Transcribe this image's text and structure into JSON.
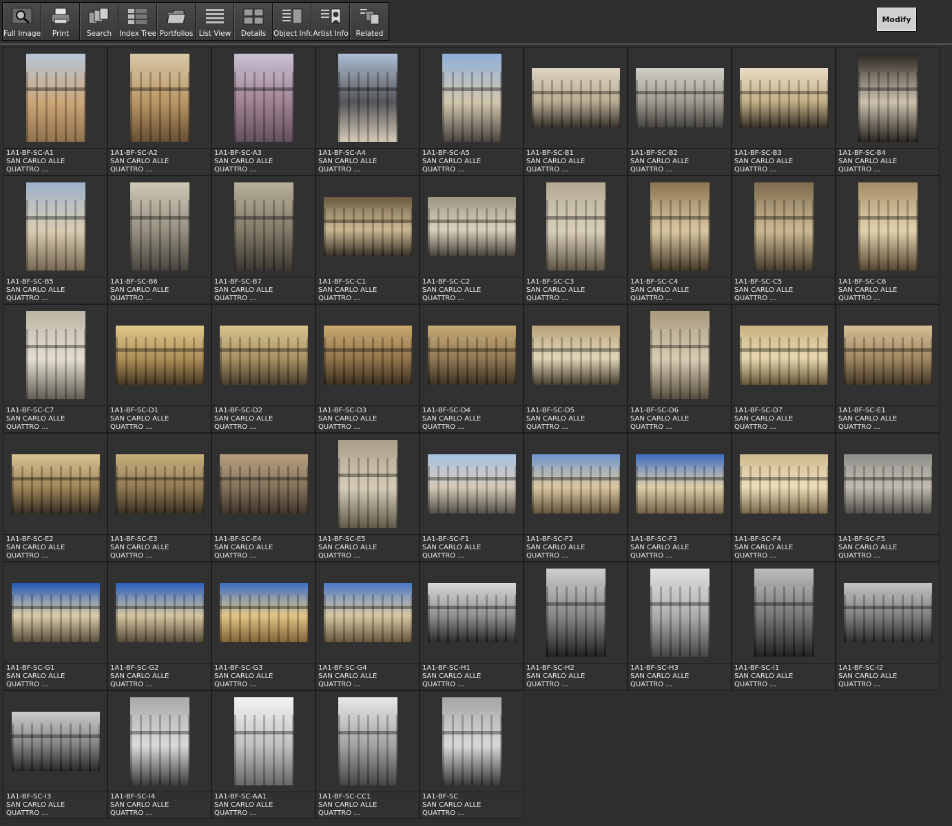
{
  "toolbar": {
    "buttons": [
      {
        "label": "Full Image",
        "icon": "magnifier-icon"
      },
      {
        "label": "Print",
        "icon": "printer-icon"
      },
      {
        "label": "Search",
        "icon": "search-stack-icon"
      },
      {
        "label": "Index Tree",
        "icon": "index-tree-icon"
      },
      {
        "label": "Portfolios",
        "icon": "folder-icon"
      },
      {
        "label": "List View",
        "icon": "list-icon"
      },
      {
        "label": "Details",
        "icon": "details-grid-icon"
      },
      {
        "label": "Object Info",
        "icon": "object-info-icon"
      },
      {
        "label": "Artist  Info",
        "icon": "artist-portrait-icon"
      },
      {
        "label": "Related",
        "icon": "related-icon"
      }
    ],
    "modify_label": "Modify"
  },
  "thumbnails": [
    {
      "id": "1A1-BF-SC-A1",
      "title": "SAN CARLO ALLE",
      "subtitle": "QUATTRO ...",
      "orient": "portrait",
      "palette": [
        "#b7c7d8",
        "#c8a070",
        "#8a6a44"
      ]
    },
    {
      "id": "1A1-BF-SC-A2",
      "title": "SAN CARLO ALLE",
      "subtitle": "QUATTRO ...",
      "orient": "portrait",
      "palette": [
        "#d8c9a8",
        "#b58f5b",
        "#5c4428"
      ]
    },
    {
      "id": "1A1-BF-SC-A3",
      "title": "SAN CARLO ALLE",
      "subtitle": "QUATTRO ...",
      "orient": "portrait",
      "palette": [
        "#c9c2d4",
        "#9a7b8c",
        "#5a4654"
      ]
    },
    {
      "id": "1A1-BF-SC-A4",
      "title": "SAN CARLO ALLE",
      "subtitle": "QUATTRO ...",
      "orient": "portrait",
      "palette": [
        "#aebfd6",
        "#4b4b4f",
        "#d2c7b1"
      ]
    },
    {
      "id": "1A1-BF-SC-A5",
      "title": "SAN CARLO ALLE",
      "subtitle": "QUATTRO ...",
      "orient": "portrait",
      "palette": [
        "#8fb0da",
        "#cfc3a9",
        "#3f3a34"
      ]
    },
    {
      "id": "1A1-BF-SC-B1",
      "title": "SAN CARLO ALLE",
      "subtitle": "QUATTRO ...",
      "orient": "landscape",
      "palette": [
        "#ddd3c0",
        "#b7a98e",
        "#2a2620"
      ]
    },
    {
      "id": "1A1-BF-SC-B2",
      "title": "SAN CARLO ALLE",
      "subtitle": "QUATTRO ...",
      "orient": "landscape",
      "palette": [
        "#d2cfc8",
        "#9b968c",
        "#3a3834"
      ]
    },
    {
      "id": "1A1-BF-SC-B3",
      "title": "SAN CARLO ALLE",
      "subtitle": "QUATTRO ...",
      "orient": "landscape",
      "palette": [
        "#e6dcc4",
        "#c3ad82",
        "#2e261a"
      ]
    },
    {
      "id": "1A1-BF-SC-B4",
      "title": "SAN CARLO ALLE",
      "subtitle": "QUATTRO ...",
      "orient": "portrait",
      "palette": [
        "#2b2722",
        "#c8bda8",
        "#1b1814"
      ]
    },
    {
      "id": "1A1-BF-SC-B5",
      "title": "SAN CARLO ALLE",
      "subtitle": "QUATTRO ...",
      "orient": "portrait",
      "palette": [
        "#9db1cc",
        "#d7c9ac",
        "#6e5f48"
      ]
    },
    {
      "id": "1A1-BF-SC-B6",
      "title": "SAN CARLO ALLE",
      "subtitle": "QUATTRO ...",
      "orient": "portrait",
      "palette": [
        "#cfc8b6",
        "#8f8878",
        "#3d3a33"
      ]
    },
    {
      "id": "1A1-BF-SC-B7",
      "title": "SAN CARLO ALLE",
      "subtitle": "QUATTRO ...",
      "orient": "portrait",
      "palette": [
        "#b9b09c",
        "#7a715f",
        "#2f2b24"
      ]
    },
    {
      "id": "1A1-BF-SC-C1",
      "title": "SAN CARLO ALLE",
      "subtitle": "QUATTRO ...",
      "orient": "landscape",
      "palette": [
        "#6b5a40",
        "#c9b58c",
        "#2c241a"
      ]
    },
    {
      "id": "1A1-BF-SC-C2",
      "title": "SAN CARLO ALLE",
      "subtitle": "QUATTRO ...",
      "orient": "landscape",
      "palette": [
        "#9c9482",
        "#d8cfba",
        "#3c372e"
      ]
    },
    {
      "id": "1A1-BF-SC-C3",
      "title": "SAN CARLO ALLE",
      "subtitle": "QUATTRO ...",
      "orient": "portrait",
      "palette": [
        "#b4aa93",
        "#d6ccb5",
        "#54493a"
      ]
    },
    {
      "id": "1A1-BF-SC-C4",
      "title": "SAN CARLO ALLE",
      "subtitle": "QUATTRO ...",
      "orient": "portrait",
      "palette": [
        "#8c7652",
        "#d7c39b",
        "#3a2e1c"
      ]
    },
    {
      "id": "1A1-BF-SC-C5",
      "title": "SAN CARLO ALLE",
      "subtitle": "QUATTRO ...",
      "orient": "portrait",
      "palette": [
        "#7d6b4e",
        "#c8b48c",
        "#3b3022"
      ]
    },
    {
      "id": "1A1-BF-SC-C6",
      "title": "SAN CARLO ALLE",
      "subtitle": "QUATTRO ...",
      "orient": "portrait",
      "palette": [
        "#a48d66",
        "#e0cfa8",
        "#4a3b25"
      ]
    },
    {
      "id": "1A1-BF-SC-C7",
      "title": "SAN CARLO ALLE",
      "subtitle": "QUATTRO ...",
      "orient": "portrait",
      "palette": [
        "#bdb6a6",
        "#e1dbcd",
        "#5a554b"
      ]
    },
    {
      "id": "1A1-BF-SC-D1",
      "title": "SAN CARLO ALLE",
      "subtitle": "QUATTRO ...",
      "orient": "landscape",
      "palette": [
        "#e0c98c",
        "#a8884e",
        "#3b2c17"
      ]
    },
    {
      "id": "1A1-BF-SC-D2",
      "title": "SAN CARLO ALLE",
      "subtitle": "QUATTRO ...",
      "orient": "landscape",
      "palette": [
        "#d9c590",
        "#a28a5b",
        "#3d3120"
      ]
    },
    {
      "id": "1A1-BF-SC-D3",
      "title": "SAN CARLO ALLE",
      "subtitle": "QUATTRO ...",
      "orient": "landscape",
      "palette": [
        "#caa86e",
        "#8c6d42",
        "#302414"
      ]
    },
    {
      "id": "1A1-BF-SC-D4",
      "title": "SAN CARLO ALLE",
      "subtitle": "QUATTRO ...",
      "orient": "landscape",
      "palette": [
        "#c7ab74",
        "#8a704a",
        "#2f2518"
      ]
    },
    {
      "id": "1A1-BF-SC-D5",
      "title": "SAN CARLO ALLE",
      "subtitle": "QUATTRO ...",
      "orient": "landscape",
      "palette": [
        "#b8a27a",
        "#e0d3b4",
        "#3b3224"
      ]
    },
    {
      "id": "1A1-BF-SC-D6",
      "title": "SAN CARLO ALLE",
      "subtitle": "QUATTRO ...",
      "orient": "portrait",
      "palette": [
        "#a99a7e",
        "#d5c9ae",
        "#4b4232"
      ]
    },
    {
      "id": "1A1-BF-SC-D7",
      "title": "SAN CARLO ALLE",
      "subtitle": "QUATTRO ...",
      "orient": "landscape",
      "palette": [
        "#c9b182",
        "#e6d5a8",
        "#5d4b2f"
      ]
    },
    {
      "id": "1A1-BF-SC-E1",
      "title": "SAN CARLO ALLE",
      "subtitle": "QUATTRO ...",
      "orient": "landscape",
      "palette": [
        "#d5c096",
        "#9b8058",
        "#3a2d1d"
      ]
    },
    {
      "id": "1A1-BF-SC-E2",
      "title": "SAN CARLO ALLE",
      "subtitle": "QUATTRO ...",
      "orient": "landscape",
      "palette": [
        "#d8c391",
        "#9c7f52",
        "#2a2115"
      ]
    },
    {
      "id": "1A1-BF-SC-E3",
      "title": "SAN CARLO ALLE",
      "subtitle": "QUATTRO ...",
      "orient": "landscape",
      "palette": [
        "#c8b07c",
        "#8c734b",
        "#2c2317"
      ]
    },
    {
      "id": "1A1-BF-SC-E4",
      "title": "SAN CARLO ALLE",
      "subtitle": "QUATTRO ...",
      "orient": "landscape",
      "palette": [
        "#b7a07f",
        "#7d6a52",
        "#33291d"
      ]
    },
    {
      "id": "1A1-BF-SC-E5",
      "title": "SAN CARLO ALLE",
      "subtitle": "QUATTRO ...",
      "orient": "portrait",
      "palette": [
        "#aa9f88",
        "#d2c8b2",
        "#56503f"
      ]
    },
    {
      "id": "1A1-BF-SC-F1",
      "title": "SAN CARLO ALLE",
      "subtitle": "QUATTRO ...",
      "orient": "landscape",
      "palette": [
        "#a8c1e0",
        "#d1c7b4",
        "#4a453c"
      ]
    },
    {
      "id": "1A1-BF-SC-F2",
      "title": "SAN CARLO ALLE",
      "subtitle": "QUATTRO ...",
      "orient": "landscape",
      "palette": [
        "#6f97cf",
        "#d9c49a",
        "#5a4a32"
      ]
    },
    {
      "id": "1A1-BF-SC-F3",
      "title": "SAN CARLO ALLE",
      "subtitle": "QUATTRO ...",
      "orient": "landscape",
      "palette": [
        "#3d6dc4",
        "#dccba4",
        "#6a5a3e"
      ]
    },
    {
      "id": "1A1-BF-SC-F4",
      "title": "SAN CARLO ALLE",
      "subtitle": "QUATTRO ...",
      "orient": "landscape",
      "palette": [
        "#cdb98f",
        "#ecdcb5",
        "#6f5e40"
      ]
    },
    {
      "id": "1A1-BF-SC-F5",
      "title": "SAN CARLO ALLE",
      "subtitle": "QUATTRO ...",
      "orient": "landscape",
      "palette": [
        "#8f8f8a",
        "#bdb8ad",
        "#45433e"
      ]
    },
    {
      "id": "1A1-BF-SC-G1",
      "title": "SAN CARLO ALLE",
      "subtitle": "QUATTRO ...",
      "orient": "landscape",
      "palette": [
        "#2457b8",
        "#d9c9a4",
        "#4f4430"
      ]
    },
    {
      "id": "1A1-BF-SC-G2",
      "title": "SAN CARLO ALLE",
      "subtitle": "QUATTRO ...",
      "orient": "landscape",
      "palette": [
        "#2a5fc0",
        "#d3c19a",
        "#4c412d"
      ]
    },
    {
      "id": "1A1-BF-SC-G3",
      "title": "SAN CARLO ALLE",
      "subtitle": "QUATTRO ...",
      "orient": "landscape",
      "palette": [
        "#3c6fc7",
        "#e0c27f",
        "#7b5a2c"
      ]
    },
    {
      "id": "1A1-BF-SC-G4",
      "title": "SAN CARLO ALLE",
      "subtitle": "QUATTRO ...",
      "orient": "landscape",
      "palette": [
        "#4b79c8",
        "#d6c49d",
        "#5c4d33"
      ]
    },
    {
      "id": "1A1-BF-SC-H1",
      "title": "SAN CARLO ALLE",
      "subtitle": "QUATTRO ...",
      "orient": "landscape",
      "palette": [
        "#d9d9d9",
        "#8a8a8a",
        "#1d1d1d"
      ]
    },
    {
      "id": "1A1-BF-SC-H2",
      "title": "SAN CARLO ALLE",
      "subtitle": "QUATTRO ...",
      "orient": "portrait",
      "palette": [
        "#cfcfcf",
        "#7c7c7c",
        "#141414"
      ]
    },
    {
      "id": "1A1-BF-SC-H3",
      "title": "SAN CARLO ALLE",
      "subtitle": "QUATTRO ...",
      "orient": "portrait",
      "palette": [
        "#e2e2e2",
        "#a6a6a6",
        "#3a3a3a"
      ]
    },
    {
      "id": "1A1-BF-SC-I1",
      "title": "SAN CARLO ALLE",
      "subtitle": "QUATTRO ...",
      "orient": "portrait",
      "palette": [
        "#bdbdbd",
        "#6c6c6c",
        "#151515"
      ]
    },
    {
      "id": "1A1-BF-SC-I2",
      "title": "SAN CARLO ALLE",
      "subtitle": "QUATTRO ...",
      "orient": "landscape",
      "palette": [
        "#c4c4c4",
        "#787878",
        "#202020"
      ]
    },
    {
      "id": "1A1-BF-SC-I3",
      "title": "SAN CARLO ALLE",
      "subtitle": "QUATTRO ...",
      "orient": "landscape",
      "palette": [
        "#cccccc",
        "#7e7e7e",
        "#1c1c1c"
      ]
    },
    {
      "id": "1A1-BF-SC-I4",
      "title": "SAN CARLO ALLE",
      "subtitle": "QUATTRO ...",
      "orient": "portrait",
      "palette": [
        "#a9a9a9",
        "#d8d8d8",
        "#2e2e2e"
      ]
    },
    {
      "id": "1A1-BF-SC-AA1",
      "title": "SAN CARLO ALLE",
      "subtitle": "QUATTRO ...",
      "orient": "portrait",
      "palette": [
        "#f4f4f4",
        "#bcbcbc",
        "#5e5e5e"
      ]
    },
    {
      "id": "1A1-BF-SC-CC1",
      "title": "SAN CARLO ALLE",
      "subtitle": "QUATTRO ...",
      "orient": "portrait",
      "palette": [
        "#e8e8e8",
        "#9c9c9c",
        "#3b3b3b"
      ]
    },
    {
      "id": "1A1-BF-SC",
      "title": "SAN CARLO ALLE",
      "subtitle": "QUATTRO ...",
      "orient": "portrait",
      "palette": [
        "#a5a5a5",
        "#d6d6d6",
        "#2c2c2c"
      ]
    }
  ]
}
